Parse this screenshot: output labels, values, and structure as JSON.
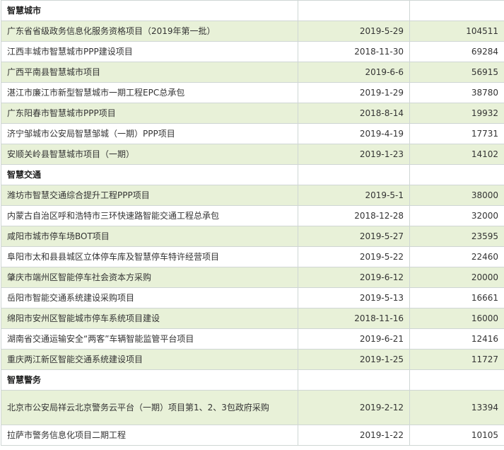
{
  "sections": [
    {
      "title": "智慧城市",
      "rows": [
        {
          "name": "广东省省级政务信息化服务资格项目（2019年第一批）",
          "date": "2019-5-29",
          "amount": "104511"
        },
        {
          "name": "江西丰城市智慧城市PPP建设项目",
          "date": "2018-11-30",
          "amount": "69284"
        },
        {
          "name": "广西平南县智慧城市项目",
          "date": "2019-6-6",
          "amount": "56915"
        },
        {
          "name": "湛江市廉江市新型智慧城市一期工程EPC总承包",
          "date": "2019-1-29",
          "amount": "38780"
        },
        {
          "name": "广东阳春市智慧城市PPP项目",
          "date": "2018-8-14",
          "amount": "19932"
        },
        {
          "name": "济宁邹城市公安局智慧邹城（一期）PPP项目",
          "date": "2019-4-19",
          "amount": "17731"
        },
        {
          "name": "安顺关岭县智慧城市项目（一期）",
          "date": "2019-1-23",
          "amount": "14102"
        }
      ]
    },
    {
      "title": "智慧交通",
      "rows": [
        {
          "name": "潍坊市智慧交通综合提升工程PPP项目",
          "date": "2019-5-1",
          "amount": "38000"
        },
        {
          "name": "内蒙古自治区呼和浩特市三环快速路智能交通工程总承包",
          "date": "2018-12-28",
          "amount": "32000"
        },
        {
          "name": "咸阳市城市停车场BOT项目",
          "date": "2019-5-27",
          "amount": "23595"
        },
        {
          "name": "阜阳市太和县县城区立体停车库及智慧停车特许经营项目",
          "date": "2019-5-22",
          "amount": "22460"
        },
        {
          "name": "肇庆市端州区智能停车社会资本方采购",
          "date": "2019-6-12",
          "amount": "20000"
        },
        {
          "name": "岳阳市智能交通系统建设采购项目",
          "date": "2019-5-13",
          "amount": "16661"
        },
        {
          "name": "绵阳市安州区智能城市停车系统项目建设",
          "date": "2018-11-16",
          "amount": "16000"
        },
        {
          "name": "湖南省交通运输安全“两客”车辆智能监管平台项目",
          "date": "2019-6-21",
          "amount": "12416"
        },
        {
          "name": "重庆两江新区智能交通系统建设项目",
          "date": "2019-1-25",
          "amount": "11727"
        }
      ]
    },
    {
      "title": "智慧警务",
      "rows": [
        {
          "name": "北京市公安局祥云北京警务云平台（一期）项目第1、2、3包政府采购",
          "date": "2019-2-12",
          "amount": "13394"
        },
        {
          "name": "拉萨市警务信息化项目二期工程",
          "date": "2019-1-22",
          "amount": "10105"
        }
      ]
    }
  ]
}
